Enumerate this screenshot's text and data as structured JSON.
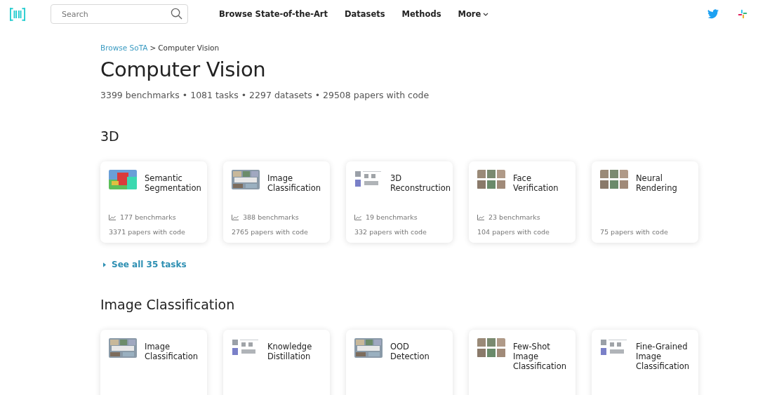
{
  "nav": {
    "search": {
      "placeholder": "Search"
    },
    "links": [
      "Browse State-of-the-Art",
      "Datasets",
      "Methods"
    ],
    "more": "More"
  },
  "breadcrumb": {
    "link": "Browse SoTA",
    "separator": ">",
    "current": "Computer Vision"
  },
  "title": "Computer Vision",
  "summary": "3399 benchmarks • 1081 tasks • 2297 datasets • 29508 papers with code",
  "sections": [
    {
      "heading": "3D",
      "see_all": "See all 35 tasks",
      "tasks": [
        {
          "name": "Semantic Segmentation",
          "benchmarks": "177 benchmarks",
          "papers": "3371 papers with code",
          "kind": "picture"
        },
        {
          "name": "Image Classification",
          "benchmarks": "388 benchmarks",
          "papers": "2765 papers with code",
          "kind": "picture"
        },
        {
          "name": "3D Reconstruction",
          "benchmarks": "19 benchmarks",
          "papers": "332 papers with code",
          "kind": "picture"
        },
        {
          "name": "Face Verification",
          "benchmarks": "23 benchmarks",
          "papers": "104 papers with code",
          "kind": "picture"
        },
        {
          "name": "Neural Rendering",
          "papers": "75 papers with code",
          "kind": "picture"
        }
      ]
    },
    {
      "heading": "Image Classification",
      "tasks": [
        {
          "name": "Image Classification",
          "kind": "picture"
        },
        {
          "name": "Knowledge Distillation",
          "kind": "picture"
        },
        {
          "name": "OOD Detection",
          "kind": "picture"
        },
        {
          "name": "Few-Shot Image Classification",
          "kind": "picture"
        },
        {
          "name": "Fine-Grained Image Classification",
          "kind": "picture"
        }
      ]
    }
  ]
}
